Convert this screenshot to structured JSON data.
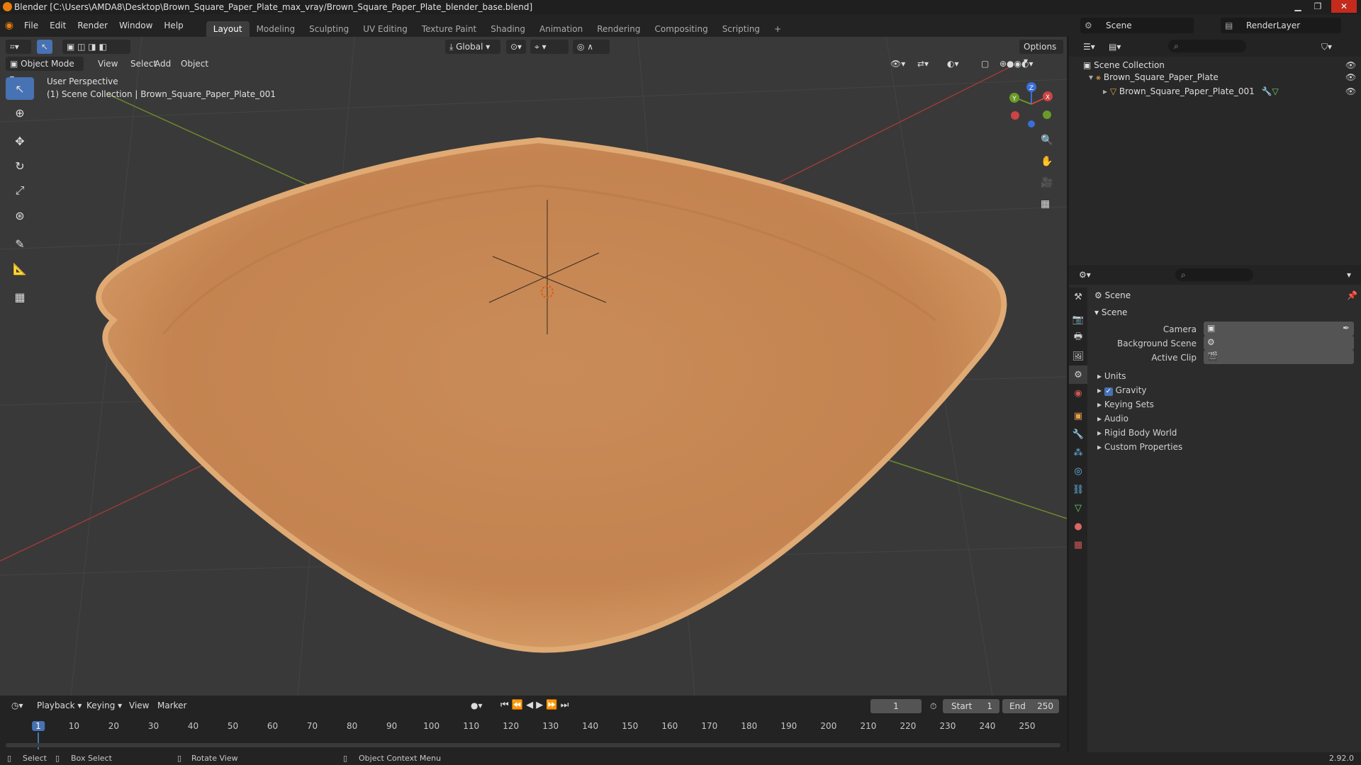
{
  "window": {
    "title": "Blender [C:\\Users\\AMDA8\\Desktop\\Brown_Square_Paper_Plate_max_vray/Brown_Square_Paper_Plate_blender_base.blend]",
    "min": "▁",
    "max": "❐",
    "close": "✕"
  },
  "menu": {
    "items": [
      "File",
      "Edit",
      "Render",
      "Window",
      "Help"
    ]
  },
  "workspaces": {
    "tabs": [
      "Layout",
      "Modeling",
      "Sculpting",
      "UV Editing",
      "Texture Paint",
      "Shading",
      "Animation",
      "Rendering",
      "Compositing",
      "Scripting"
    ],
    "add": "+"
  },
  "scene": {
    "label": "Scene",
    "render_layer": "RenderLayer"
  },
  "viewport": {
    "mode": "Object Mode",
    "menus": [
      "View",
      "Select",
      "Add",
      "Object"
    ],
    "transform": "Global",
    "options": "Options",
    "perspective": "User Perspective",
    "collection_info": "(1) Scene Collection | Brown_Square_Paper_Plate_001",
    "gizmo": {
      "x": "X",
      "y": "Y",
      "z": "Z"
    }
  },
  "outliner": {
    "root": "Scene Collection",
    "items": [
      {
        "name": "Brown_Square_Paper_Plate"
      },
      {
        "name": "Brown_Square_Paper_Plate_001"
      }
    ]
  },
  "properties": {
    "header": "Scene",
    "section": "Scene",
    "camera_label": "Camera",
    "background_label": "Background Scene",
    "clip_label": "Active Clip",
    "panels": [
      "Units",
      "Gravity",
      "Keying Sets",
      "Audio",
      "Rigid Body World",
      "Custom Properties"
    ],
    "gravity_checked": true
  },
  "timeline": {
    "menus": [
      "Playback",
      "Keying",
      "View",
      "Marker"
    ],
    "current_frame": "1",
    "start_label": "Start",
    "start": "1",
    "end_label": "End",
    "end": "250",
    "ticks": [
      "1",
      "10",
      "20",
      "30",
      "40",
      "50",
      "60",
      "70",
      "80",
      "90",
      "100",
      "110",
      "120",
      "130",
      "140",
      "150",
      "160",
      "170",
      "180",
      "190",
      "200",
      "210",
      "220",
      "230",
      "240",
      "250"
    ],
    "current_frame_value": 1,
    "frame_range": [
      1,
      250
    ]
  },
  "status": {
    "select": "Select",
    "box_select": "Box Select",
    "rotate": "Rotate View",
    "context": "Object Context Menu",
    "version": "2.92.0"
  },
  "colors": {
    "accent": "#4772b3",
    "plate": "#c8874f",
    "header": "#232323"
  }
}
